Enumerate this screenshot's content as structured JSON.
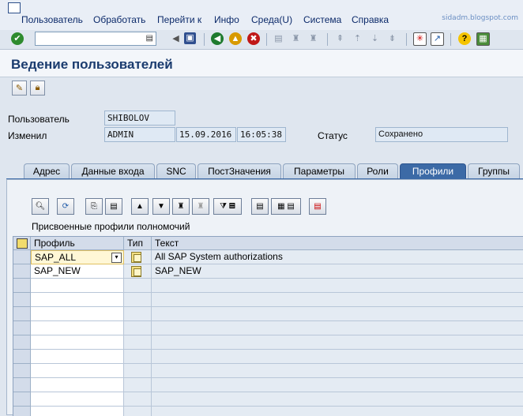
{
  "menu": {
    "items": [
      "Пользователь",
      "Обработать",
      "Перейти к",
      "Инфо",
      "Среда(U)",
      "Система",
      "Справка"
    ],
    "watermark": "sidadm.blogspot.com"
  },
  "toolbar": {
    "command_field_value": "",
    "icons": [
      "enter-icon",
      "save-icon",
      "back-icon",
      "exit-icon",
      "cancel-icon",
      "print-icon",
      "find-icon",
      "find-next-icon",
      "first-page-icon",
      "previous-page-icon",
      "next-page-icon",
      "last-page-icon",
      "create-session-icon",
      "shortcut-icon",
      "help-icon",
      "layout-icon"
    ]
  },
  "title": "Ведение пользователей",
  "header": {
    "user_label": "Пользователь",
    "user_value": "SHIBOLOV",
    "changed_label": "Изменил",
    "changed_by": "ADMIN",
    "changed_date": "15.09.2016",
    "changed_time": "16:05:38",
    "status_label": "Статус",
    "status_value": "Сохранено"
  },
  "tabs": [
    {
      "label": "Адрес",
      "active": false
    },
    {
      "label": "Данные входа",
      "active": false
    },
    {
      "label": "SNC",
      "active": false
    },
    {
      "label": "ПостЗначения",
      "active": false
    },
    {
      "label": "Параметры",
      "active": false
    },
    {
      "label": "Роли",
      "active": false
    },
    {
      "label": "Профили",
      "active": true
    },
    {
      "label": "Группы",
      "active": false
    }
  ],
  "grid": {
    "title": "Присвоенные профили полномочий",
    "columns": {
      "profile": "Профиль",
      "type": "Тип",
      "text": "Текст"
    },
    "rows": [
      {
        "profile": "SAP_ALL",
        "text": "All SAP System authorizations"
      },
      {
        "profile": "SAP_NEW",
        "text": "SAP_NEW"
      }
    ]
  },
  "colors": {
    "accent": "#3c6aa6",
    "title_text": "#1a3b6e",
    "background": "#dfe6ef"
  }
}
